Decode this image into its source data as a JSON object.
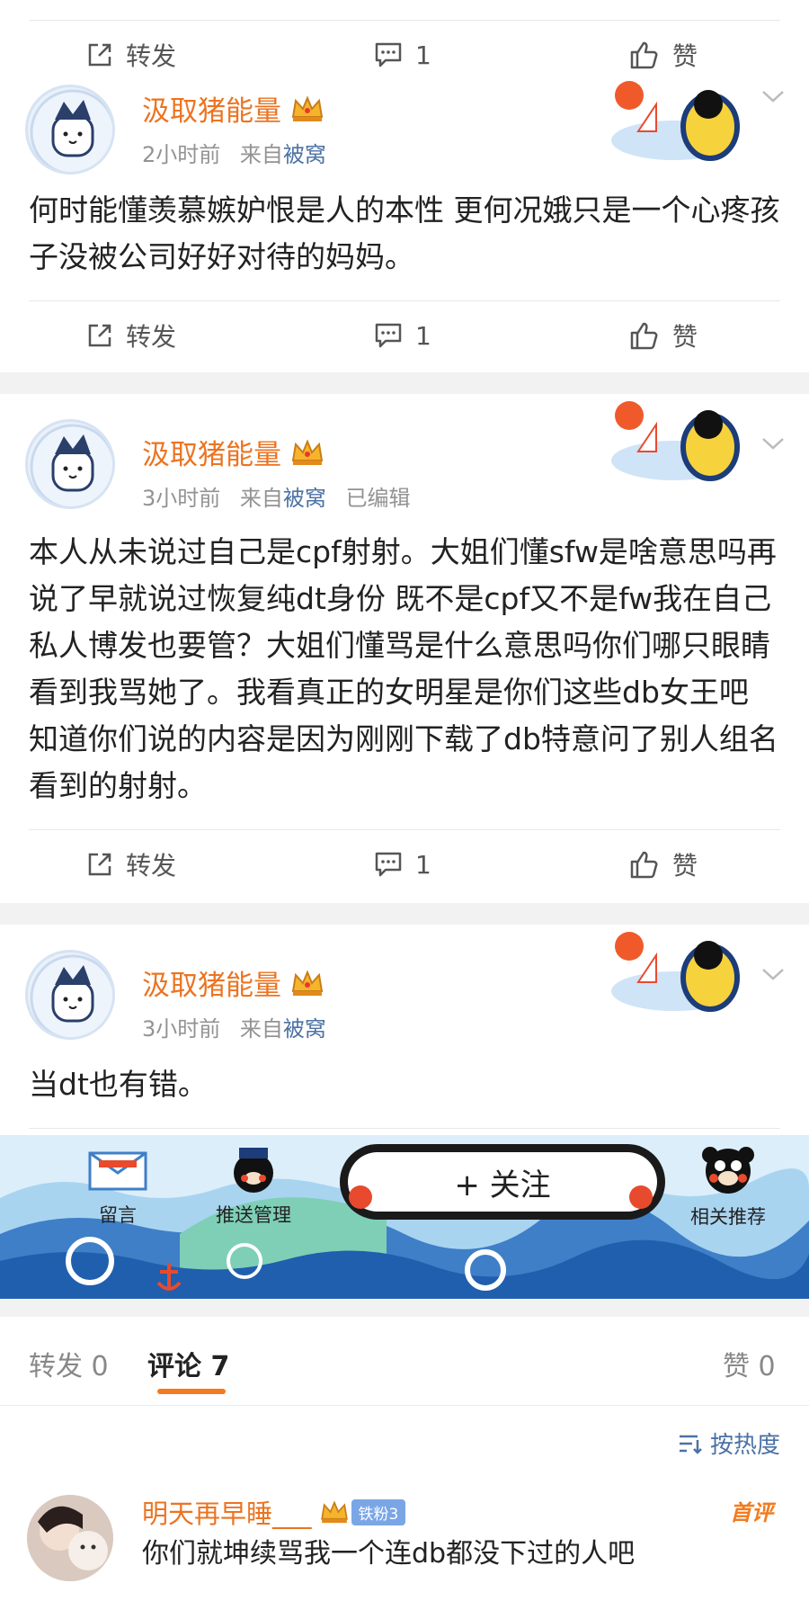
{
  "posts": [
    {
      "username": "汲取猪能量",
      "time": "2小时前",
      "source_prefix": "来自",
      "source": "被窝",
      "edited": "",
      "text": "何时能懂羡慕嫉妒恨是人的本性 更何况娥只是一个心疼孩子没被公司好好对待的妈妈。",
      "repost_label": "转发",
      "comment_count": "1",
      "like_label": "赞"
    },
    {
      "username": "汲取猪能量",
      "time": "3小时前",
      "source_prefix": "来自",
      "source": "被窝",
      "edited": "已编辑",
      "text": "本人从未说过自己是cpf射射。大姐们懂sfw是啥意思吗再说了早就说过恢复纯dt身份 既不是cpf又不是fw我在自己私人博发也要管？大姐们懂骂是什么意思吗你们哪只眼睛看到我骂她了。我看真正的女明星是你们这些db女王吧 知道你们说的内容是因为刚刚下载了db特意问了别人组名看到的射射。",
      "repost_label": "转发",
      "comment_count": "1",
      "like_label": "赞"
    },
    {
      "username": "汲取猪能量",
      "time": "3小时前",
      "source_prefix": "来自",
      "source": "被窝",
      "edited": "",
      "text": "当dt也有错。"
    }
  ],
  "top_actions": {
    "repost_label": "转发",
    "comment_count": "1",
    "like_label": "赞"
  },
  "banner": {
    "message_label": "留言",
    "push_label": "推送管理",
    "follow_label": "+ 关注",
    "related_label": "相关推荐"
  },
  "tabs": {
    "repost_label": "转发",
    "repost_count": "0",
    "comment_label": "评论",
    "comment_count": "7",
    "like_label": "赞",
    "like_count": "0"
  },
  "sort_label": "按热度",
  "comments": [
    {
      "username": "明天再早睡___",
      "fan_badge": "铁粉3",
      "tag": "首评",
      "text": "你们就坤续骂我一个连db都没下过的人吧"
    }
  ],
  "colors": {
    "username": "#eb7422",
    "source_link": "#4c72a4",
    "accent": "#f27b1f",
    "banner_sea": "#1f5fae"
  },
  "icons": [
    "share-icon",
    "comment-icon",
    "like-icon",
    "chevron-down-icon",
    "crown-icon",
    "sort-icon"
  ]
}
